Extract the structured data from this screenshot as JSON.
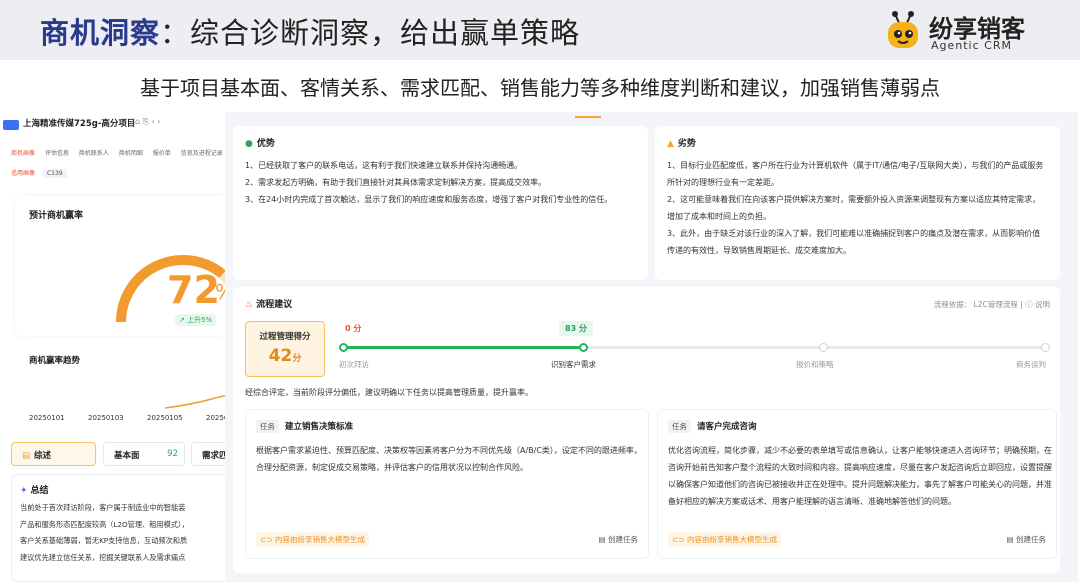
{
  "banner": {
    "title_accent": "商机洞察",
    "title_rest": "：综合诊断洞察，给出赢单策略",
    "brand_name": "纷享销客",
    "brand_sub": "Agentic CRM"
  },
  "subtitle": "基于项目基本面、客情关系、需求匹配、销售能力等多种维度判断和建议，加强销售薄弱点",
  "left_panel": {
    "project_tag": "商机",
    "project_title": "上海精准传媒725g-高分项目",
    "project_icons": "⌂  ⎘  ‹ ›",
    "tabs": [
      "商机画像",
      "评估信息",
      "商机联系人",
      "商机明细",
      "报价单",
      "信息及进程记录"
    ],
    "tag_primary": "适用画像",
    "tag_secondary": "C139",
    "win_rate": {
      "label": "预计商机赢率",
      "value": "72",
      "percent": 0.72,
      "change": "↗ 上升5%"
    },
    "trend": {
      "label": "商机赢率趋势",
      "dates": [
        "20250101",
        "20250103",
        "20250105",
        "20250"
      ]
    },
    "summary_tabs": [
      {
        "label": "综述",
        "value": ""
      },
      {
        "label": "基本面",
        "value": "92"
      },
      {
        "label": "需求匹",
        "value": ""
      }
    ],
    "summary": {
      "title": "总结",
      "text": "当前处于首次拜访阶段，客户属于制造业中的智能装\n产品和服务形态匹配度较高（L2O管理、租用模式），\n客户关系基础薄弱，暂无KP支持信息，互动频次和质\n建议优先建立信任关系，挖掘关键联系人及需求痛点"
    }
  },
  "advantages": {
    "title": "优势",
    "text": "1、已经获取了客户的联系电话，这有利于我们快速建立联系并保持沟通畅通。\n2、需求发起方明确，有助于我们直接针对其具体需求定制解决方案，提高成交效率。\n3、在24小时内完成了首次触达，显示了我们的响应速度和服务态度，增强了客户对我们专业性的信任。"
  },
  "disadvantages": {
    "title": "劣势",
    "text": "1、目标行业匹配度低，客户所在行业为计算机软件（属于IT/通信/电子/互联网大类），与我们的产品或服务所针对的理想行业有一定差距。\n2、这可能意味着我们在向该客户提供解决方案时，需要额外投入资源来调整现有方案以适应其特定需求，增加了成本和时间上的负担。\n3、此外，由于缺乏对该行业的深入了解，我们可能难以准确捕捉到客户的痛点及潜在需求，从而影响价值传递的有效性，导致销售周期延长、成交难度加大。"
  },
  "flow": {
    "title": "流程建议",
    "basis": "流程依据：  L2C管理流程  |  ⓘ 说明",
    "score_label": "过程管理得分",
    "score_value": "42",
    "score_unit": "分",
    "progress": 0.34,
    "badges": [
      "0 分",
      "83 分"
    ],
    "stages": [
      "初次拜访",
      "识别客户需求",
      "报价和策略",
      "商务谈判"
    ],
    "evaluation": "经综合评定，当前阶段评分偏低，建议明确以下任务以提高管理质量，提升赢率。"
  },
  "tasks": [
    {
      "tag": "任务",
      "title": "建立销售决策标准",
      "body": "根据客户需求紧迫性、预算匹配度、决策权等因素将客户分为不同优先级（A/B/C类），设定不同的跟进频率，合理分配资源，制定促成交易策略，并评估客户的信用状况以控制合作风险。",
      "generated": "内容由纷享销售大模型生成",
      "create": "创建任务"
    },
    {
      "tag": "任务",
      "title": "请客户完成咨询",
      "body": "优化咨询流程，简化步骤，减少不必要的表单填写或信息确认，让客户能够快速进入咨询环节；明确预期，在咨询开始前告知客户整个流程的大致时间和内容。提高响应速度，尽量在客户发起咨询后立即回应，设置提醒以确保客户知道他们的咨询已被接收并正在处理中。提升问题解决能力，事先了解客户可能关心的问题，并准备好相应的解决方案或话术、用客户能理解的语言清晰、准确地解答他们的问题。",
      "generated": "内容由纷享销售大模型生成",
      "create": "创建任务"
    }
  ],
  "colors": {
    "brand_blue": "#2b3a8c",
    "accent_orange": "#f39a2e",
    "success_green": "#22b35e",
    "warning_red": "#e0533a"
  }
}
